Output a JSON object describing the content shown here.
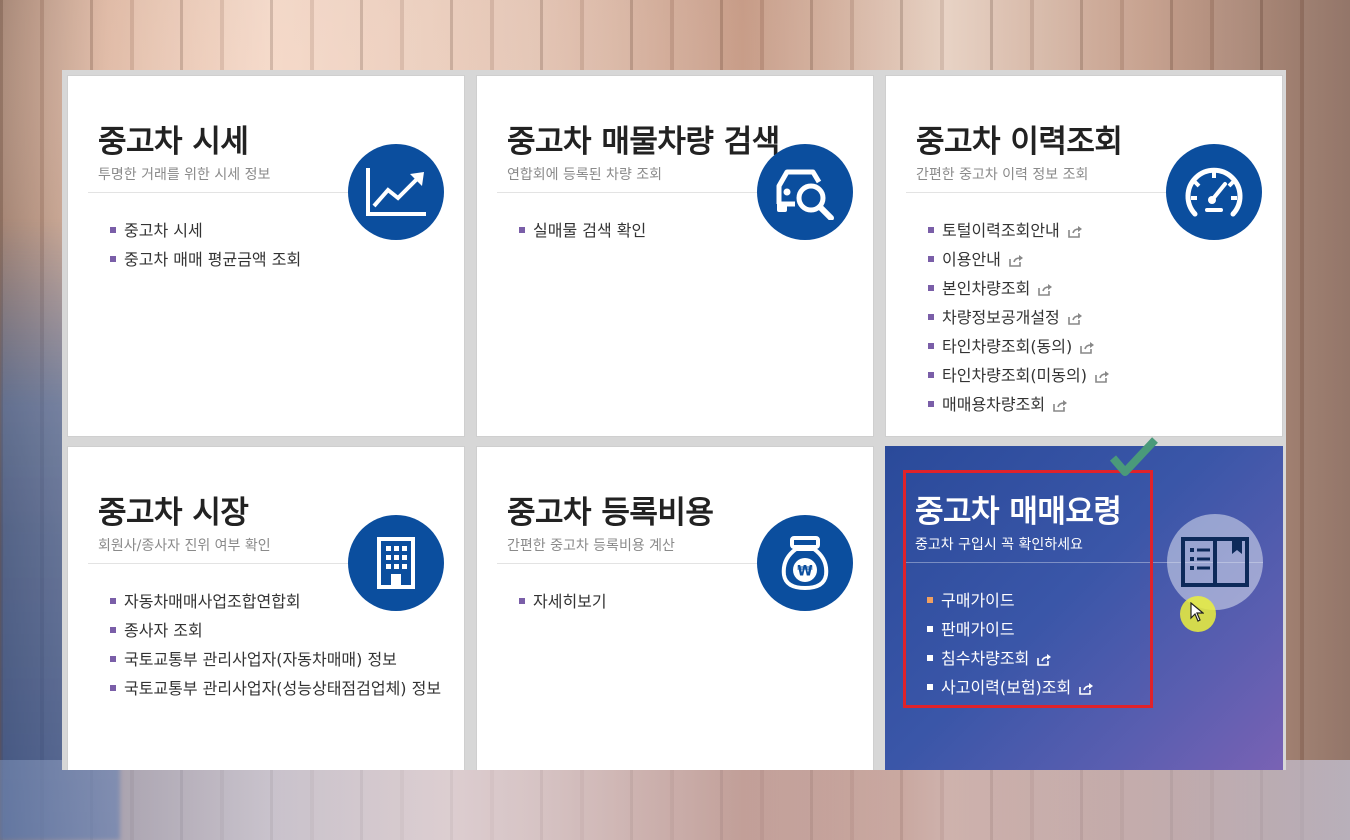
{
  "cards": [
    {
      "title": "중고차 시세",
      "subtitle": "투명한 거래를 위한 시세 정보",
      "icon": "chart-up-icon",
      "links": [
        "중고차 시세",
        "중고차 매매 평균금액 조회"
      ]
    },
    {
      "title": "중고차 매물차량 검색",
      "subtitle": "연합회에 등록된 차량 조회",
      "icon": "car-search-icon",
      "links": [
        "실매물 검색 확인"
      ]
    },
    {
      "title": "중고차 이력조회",
      "subtitle": "간편한 중고차 이력 정보 조회",
      "icon": "speedometer-icon",
      "links": [
        "토털이력조회안내",
        "이용안내",
        "본인차량조회",
        "차량정보공개설정",
        "타인차량조회(동의)",
        "타인차량조회(미동의)",
        "매매용차량조회"
      ]
    },
    {
      "title": "중고차 시장",
      "subtitle": "회원사/종사자 진위 여부 확인",
      "icon": "building-icon",
      "links": [
        "자동차매매사업조합연합회",
        "종사자 조회",
        "국토교통부 관리사업자(자동차매매) 정보",
        "국토교통부 관리사업자(성능상태점검업체) 정보"
      ]
    },
    {
      "title": "중고차 등록비용",
      "subtitle": "간편한 중고차 등록비용 계산",
      "icon": "money-bag-won-icon",
      "links": [
        "자세히보기"
      ]
    },
    {
      "title": "중고차 매매요령",
      "subtitle": "중고차 구입시 꼭 확인하세요",
      "icon": "book-icon",
      "links": [
        "구매가이드",
        "판매가이드",
        "침수차량조회",
        "사고이력(보험)조회"
      ]
    }
  ],
  "colors": {
    "icon_blue": "#0b4e9e",
    "highlight_gradient_start": "#2a4a9a",
    "highlight_gradient_end": "#7a62b4",
    "annotation_red": "#e0222a",
    "check_green": "#4a9a7a",
    "bullet": "#7a5ea8"
  }
}
